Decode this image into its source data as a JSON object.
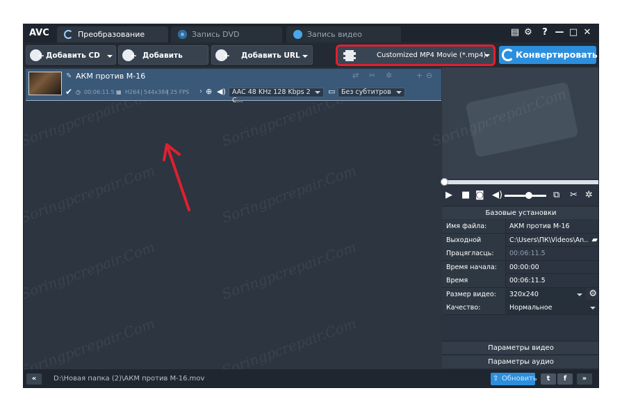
{
  "app": {
    "logo": "AVC",
    "tabs": [
      {
        "label": "Преобразование",
        "icon": "refresh-icon",
        "active": true
      },
      {
        "label": "Запись DVD",
        "icon": "disc-icon",
        "active": false
      },
      {
        "label": "Запись видео",
        "icon": "record-icon",
        "active": false
      }
    ],
    "window_controls": {
      "tasks": "▤",
      "settings": "⚙",
      "help": "?",
      "minimize": "—",
      "maximize": "□",
      "close": "✕"
    }
  },
  "toolbar": {
    "add_cd": "Добавить CD диск",
    "add_video": "Добавить видео",
    "add_url": "Добавить URL",
    "profile": "Customized MP4 Movie (*.mp4)",
    "convert": "Конвертировать!"
  },
  "file": {
    "name": "АКМ против М-16",
    "duration": "00:06:11.5",
    "codec": "H264",
    "resolution": "544x384",
    "fps": "25 FPS",
    "audio": "AAC 48 KHz 128 Kbps 2 C...",
    "subtitles": "Без субтитров"
  },
  "watermark": "Soringpcrepair.Com",
  "panel": {
    "basic_header": "Базовые установки",
    "props": [
      {
        "key": "Имя файла:",
        "value": "АКМ против М-16"
      },
      {
        "key": "Выходной каталог:",
        "value": "C:\\Users\\ПК\\Videos\\An..."
      },
      {
        "key": "Працягласць:",
        "value": "00:06:11.5"
      },
      {
        "key": "Время начала:",
        "value": "00:00:00"
      },
      {
        "key": "Время остановки:",
        "value": "00:06:11.5"
      },
      {
        "key": "Размер видео:",
        "value": "320x240"
      },
      {
        "key": "Качество:",
        "value": "Нормальное"
      }
    ],
    "video_params": "Параметры видео",
    "audio_params": "Параметры аудио"
  },
  "status": {
    "collapse": "«",
    "path": "D:\\Новая папка (2)\\АКМ против М-16.mov",
    "update": "Обновить",
    "expand": "»"
  },
  "colors": {
    "accent": "#2c8fde",
    "highlight": "#e0202f",
    "selected_row": "#3a5877"
  }
}
